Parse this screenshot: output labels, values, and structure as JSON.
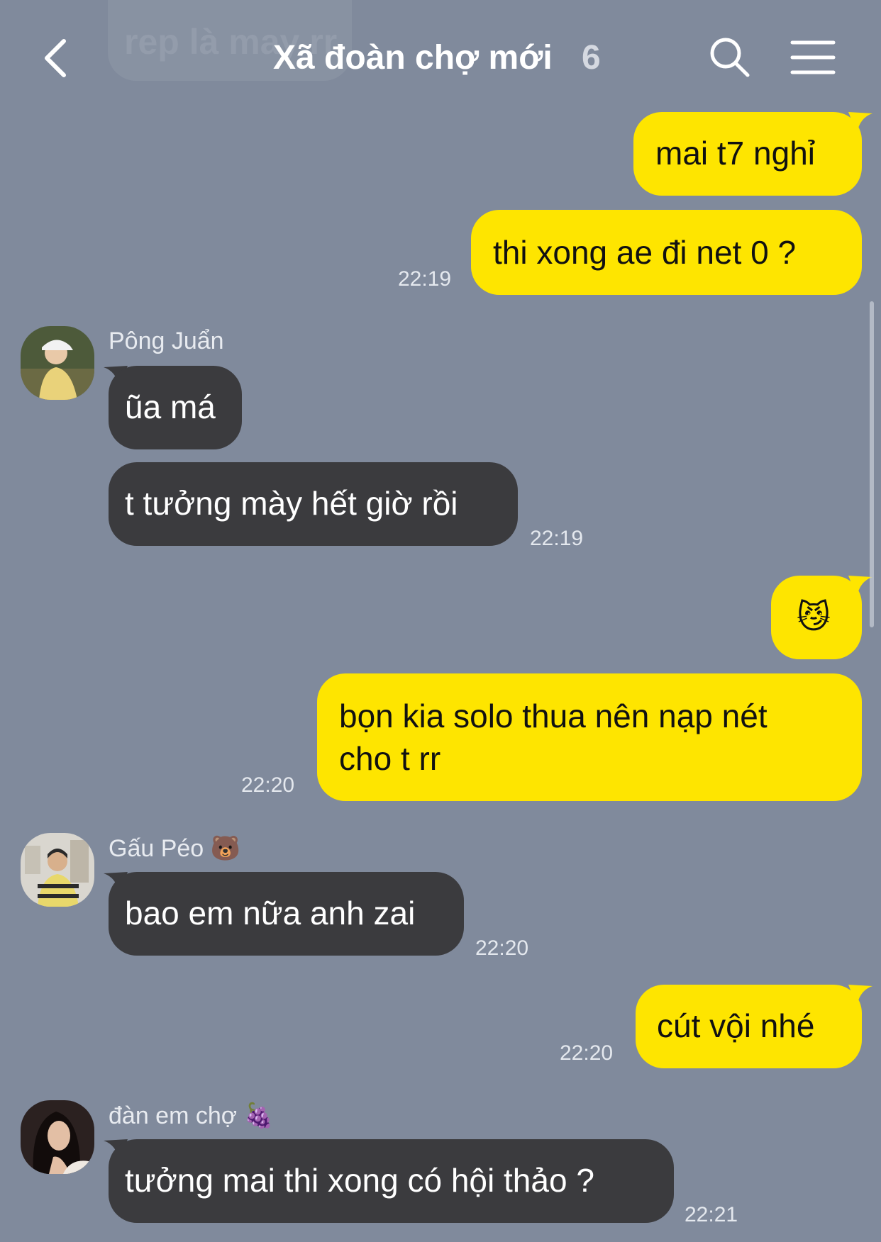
{
  "header": {
    "title": "Xã đoàn chợ mới",
    "member_count": "6",
    "ghost_message": "rep là may rr"
  },
  "messages": {
    "m1": {
      "text": "mai t7 nghỉ"
    },
    "m2": {
      "text": "thi xong ae đi net 0 ?",
      "time": "22:19"
    },
    "g1": {
      "sender": "Pông Juẩn",
      "b1": "ũa má",
      "b2": "t tưởng mày hết giờ rồi",
      "time": "22:19"
    },
    "m3": {
      "text": "😼"
    },
    "m4": {
      "line1": "bọn kia solo thua nên nạp nét",
      "line2": "cho t rr",
      "time": "22:20"
    },
    "g2": {
      "sender": "Gấu Péo 🐻",
      "b1": "bao em nữa anh zai",
      "time": "22:20"
    },
    "m5": {
      "text": "cút vội nhé",
      "time": "22:20"
    },
    "g3": {
      "sender": "đàn em chợ 🍇",
      "b1": "tưởng mai thi xong có hội thảo ?",
      "time": "22:21"
    }
  },
  "colors": {
    "background": "#808a9c",
    "my_bubble": "#fee500",
    "their_bubble": "#3b3b3e"
  },
  "icons": [
    "back-arrow-icon",
    "search-icon",
    "hamburger-menu-icon"
  ]
}
